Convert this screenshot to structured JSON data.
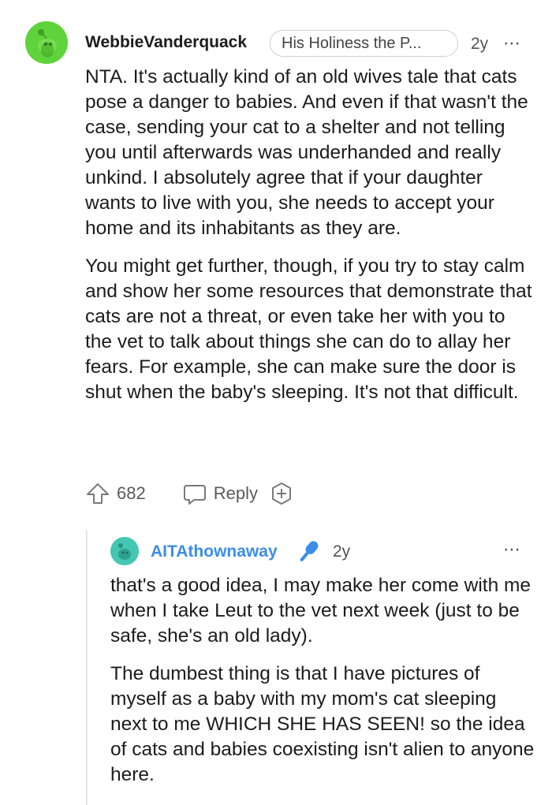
{
  "comment": {
    "username": "WebbieVanderquack",
    "flair": "His Holiness the P...",
    "age": "2y",
    "more_icon": "⋯",
    "paragraphs": [
      "NTA. It's actually kind of an old wives tale that cats pose a danger to babies. And even if that wasn't the case, sending your cat to a shelter and not telling you until afterwards was underhanded and really unkind. I absolutely agree that if your daughter wants to live with you, she needs to accept your home and its inhabitants as they are.",
      "You might get further, though, if you try to stay calm and show her some resources that demonstrate that cats are not a threat, or even take her with you to the vet to talk about things she can do to allay her fears. For example, she can make sure the door is shut when the baby's sleeping. It's not that difficult."
    ],
    "actions": {
      "upvote_count": "682",
      "reply_label": "Reply"
    }
  },
  "reply": {
    "username": "AITAthownaway",
    "age": "2y",
    "more_icon": "⋯",
    "paragraphs": [
      "that's a good idea, I may make her come with me when I take Leut to the vet next week (just to be safe, she's an old lady).",
      "The dumbest thing is that I have pictures of myself as a baby with my mom's cat sleeping next to me WHICH SHE HAS SEEN! so the idea of cats and babies coexisting isn't alien to anyone here."
    ]
  },
  "colors": {
    "avatar_green": "#5fd33b",
    "avatar_teal": "#43c7b3",
    "op_blue": "#3c8de6"
  }
}
